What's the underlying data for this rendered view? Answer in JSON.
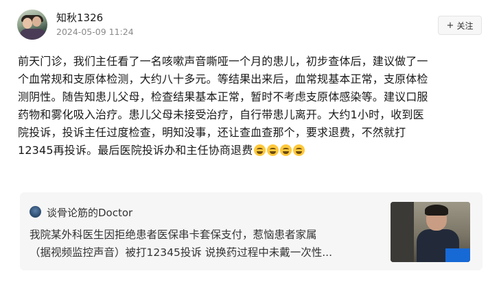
{
  "author": {
    "name": "知秋1326",
    "timestamp": "2024-05-09 11:24"
  },
  "follow_button": {
    "icon": "plus-icon",
    "plus": "+",
    "label": "关注"
  },
  "post": {
    "lines": [
      "前天门诊，我们主任看了一名咳嗽声音嘶哑一个月的患儿，初步查体后，建议做了一",
      "个血常规和支原体检测，大约八十多元。等结果出来后，血常规基本正常，支原体检",
      "测阴性。随告知患儿父母，检查结果基本正常，暂时不考虑支原体感染等。建议口服",
      "药物和雾化吸入治疗。患儿父母未接受治疗，自行带患儿离开。大约1小时，收到医",
      "院投诉，投诉主任过度检查，明知没事，还让查血查那个，要求退费，不然就打",
      "12345再投诉。最后医院投诉办和主任协商退费"
    ],
    "emoji": [
      "laugh-cry-emoji",
      "laugh-cry-emoji",
      "laugh-cry-emoji",
      "laugh-cry-emoji"
    ]
  },
  "repost": {
    "source_name": "谈骨论筋的Doctor",
    "lines": [
      "我院某外科医生因拒绝患者医保串卡套保支付，惹恼患者家属",
      "（据视频监控声音）被打12345投诉 说换药过程中未戴一次性..."
    ],
    "thumbnail": "video-thumbnail"
  }
}
